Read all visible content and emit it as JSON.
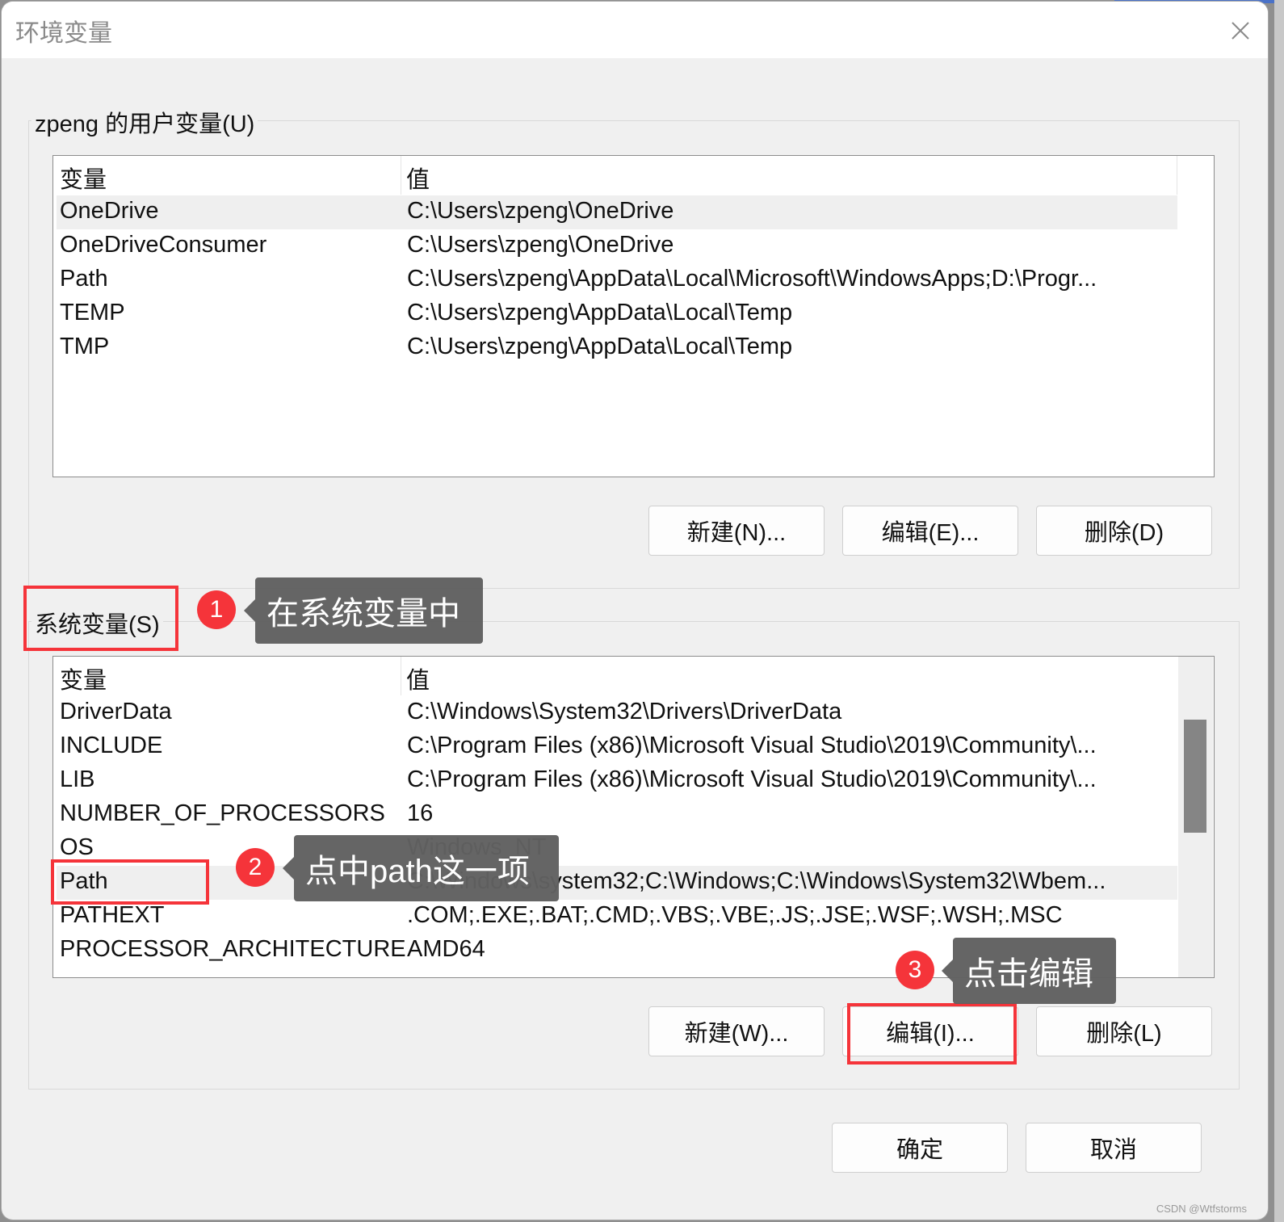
{
  "window": {
    "title": "环境变量",
    "close_icon": "close-icon"
  },
  "user_vars": {
    "group_label": "zpeng 的用户变量(U)",
    "columns": [
      "变量",
      "值"
    ],
    "rows": [
      {
        "name": "OneDrive",
        "value": "C:\\Users\\zpeng\\OneDrive",
        "selected": true
      },
      {
        "name": "OneDriveConsumer",
        "value": "C:\\Users\\zpeng\\OneDrive"
      },
      {
        "name": "Path",
        "value": "C:\\Users\\zpeng\\AppData\\Local\\Microsoft\\WindowsApps;D:\\Progr..."
      },
      {
        "name": "TEMP",
        "value": "C:\\Users\\zpeng\\AppData\\Local\\Temp"
      },
      {
        "name": "TMP",
        "value": "C:\\Users\\zpeng\\AppData\\Local\\Temp"
      }
    ],
    "buttons": {
      "new": "新建(N)...",
      "edit": "编辑(E)...",
      "delete": "删除(D)"
    }
  },
  "system_vars": {
    "group_label": "系统变量(S)",
    "columns": [
      "变量",
      "值"
    ],
    "rows": [
      {
        "name": "DriverData",
        "value": "C:\\Windows\\System32\\Drivers\\DriverData"
      },
      {
        "name": "INCLUDE",
        "value": "C:\\Program Files (x86)\\Microsoft Visual Studio\\2019\\Community\\..."
      },
      {
        "name": "LIB",
        "value": "C:\\Program Files (x86)\\Microsoft Visual Studio\\2019\\Community\\..."
      },
      {
        "name": "NUMBER_OF_PROCESSORS",
        "value": "16"
      },
      {
        "name": "OS",
        "value": "Windows_NT"
      },
      {
        "name": "Path",
        "value": "C:\\Windows\\system32;C:\\Windows;C:\\Windows\\System32\\Wbem...",
        "selected": true
      },
      {
        "name": "PATHEXT",
        "value": ".COM;.EXE;.BAT;.CMD;.VBS;.VBE;.JS;.JSE;.WSF;.WSH;.MSC"
      },
      {
        "name": "PROCESSOR_ARCHITECTURE",
        "value": "AMD64"
      }
    ],
    "buttons": {
      "new": "新建(W)...",
      "edit": "编辑(I)...",
      "delete": "删除(L)"
    }
  },
  "footer": {
    "ok": "确定",
    "cancel": "取消"
  },
  "annotations": [
    {
      "number": "1",
      "text": "在系统变量中"
    },
    {
      "number": "2",
      "text": "点中path这一项"
    },
    {
      "number": "3",
      "text": "点击编辑"
    }
  ],
  "annotation_color": "#f5343a",
  "watermark": "CSDN @Wtfstorms"
}
